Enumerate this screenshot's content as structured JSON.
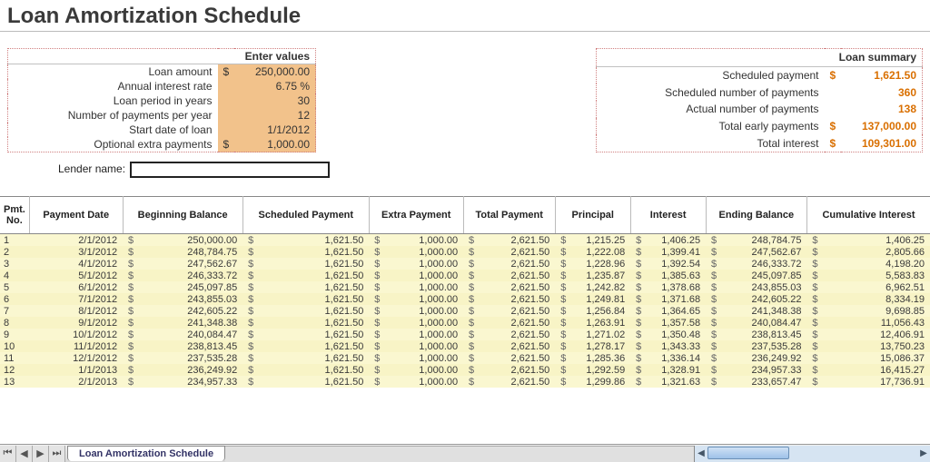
{
  "title": "Loan Amortization Schedule",
  "enter_values": {
    "header": "Enter values",
    "rows": [
      {
        "label": "Loan amount",
        "sym": "$",
        "value": "250,000.00"
      },
      {
        "label": "Annual interest rate",
        "sym": "",
        "value": "6.75  %"
      },
      {
        "label": "Loan period in years",
        "sym": "",
        "value": "30"
      },
      {
        "label": "Number of payments per year",
        "sym": "",
        "value": "12"
      },
      {
        "label": "Start date of loan",
        "sym": "",
        "value": "1/1/2012"
      },
      {
        "label": "Optional extra payments",
        "sym": "$",
        "value": "1,000.00"
      }
    ]
  },
  "loan_summary": {
    "header": "Loan summary",
    "rows": [
      {
        "label": "Scheduled payment",
        "sym": "$",
        "value": "1,621.50"
      },
      {
        "label": "Scheduled number of payments",
        "sym": "",
        "value": "360"
      },
      {
        "label": "Actual number of payments",
        "sym": "",
        "value": "138"
      },
      {
        "label": "Total early payments",
        "sym": "$",
        "value": "137,000.00"
      },
      {
        "label": "Total interest",
        "sym": "$",
        "value": "109,301.00"
      }
    ]
  },
  "lender": {
    "label": "Lender name:",
    "value": ""
  },
  "schedule": {
    "columns": [
      "Pmt. No.",
      "Payment Date",
      "Beginning Balance",
      "Scheduled Payment",
      "Extra Payment",
      "Total Payment",
      "Principal",
      "Interest",
      "Ending Balance",
      "Cumulative Interest"
    ],
    "rows": [
      {
        "no": "1",
        "date": "2/1/2012",
        "begin": "250,000.00",
        "sched": "1,621.50",
        "extra": "1,000.00",
        "total": "2,621.50",
        "principal": "1,215.25",
        "interest": "1,406.25",
        "end": "248,784.75",
        "cum": "1,406.25"
      },
      {
        "no": "2",
        "date": "3/1/2012",
        "begin": "248,784.75",
        "sched": "1,621.50",
        "extra": "1,000.00",
        "total": "2,621.50",
        "principal": "1,222.08",
        "interest": "1,399.41",
        "end": "247,562.67",
        "cum": "2,805.66"
      },
      {
        "no": "3",
        "date": "4/1/2012",
        "begin": "247,562.67",
        "sched": "1,621.50",
        "extra": "1,000.00",
        "total": "2,621.50",
        "principal": "1,228.96",
        "interest": "1,392.54",
        "end": "246,333.72",
        "cum": "4,198.20"
      },
      {
        "no": "4",
        "date": "5/1/2012",
        "begin": "246,333.72",
        "sched": "1,621.50",
        "extra": "1,000.00",
        "total": "2,621.50",
        "principal": "1,235.87",
        "interest": "1,385.63",
        "end": "245,097.85",
        "cum": "5,583.83"
      },
      {
        "no": "5",
        "date": "6/1/2012",
        "begin": "245,097.85",
        "sched": "1,621.50",
        "extra": "1,000.00",
        "total": "2,621.50",
        "principal": "1,242.82",
        "interest": "1,378.68",
        "end": "243,855.03",
        "cum": "6,962.51"
      },
      {
        "no": "6",
        "date": "7/1/2012",
        "begin": "243,855.03",
        "sched": "1,621.50",
        "extra": "1,000.00",
        "total": "2,621.50",
        "principal": "1,249.81",
        "interest": "1,371.68",
        "end": "242,605.22",
        "cum": "8,334.19"
      },
      {
        "no": "7",
        "date": "8/1/2012",
        "begin": "242,605.22",
        "sched": "1,621.50",
        "extra": "1,000.00",
        "total": "2,621.50",
        "principal": "1,256.84",
        "interest": "1,364.65",
        "end": "241,348.38",
        "cum": "9,698.85"
      },
      {
        "no": "8",
        "date": "9/1/2012",
        "begin": "241,348.38",
        "sched": "1,621.50",
        "extra": "1,000.00",
        "total": "2,621.50",
        "principal": "1,263.91",
        "interest": "1,357.58",
        "end": "240,084.47",
        "cum": "11,056.43"
      },
      {
        "no": "9",
        "date": "10/1/2012",
        "begin": "240,084.47",
        "sched": "1,621.50",
        "extra": "1,000.00",
        "total": "2,621.50",
        "principal": "1,271.02",
        "interest": "1,350.48",
        "end": "238,813.45",
        "cum": "12,406.91"
      },
      {
        "no": "10",
        "date": "11/1/2012",
        "begin": "238,813.45",
        "sched": "1,621.50",
        "extra": "1,000.00",
        "total": "2,621.50",
        "principal": "1,278.17",
        "interest": "1,343.33",
        "end": "237,535.28",
        "cum": "13,750.23"
      },
      {
        "no": "11",
        "date": "12/1/2012",
        "begin": "237,535.28",
        "sched": "1,621.50",
        "extra": "1,000.00",
        "total": "2,621.50",
        "principal": "1,285.36",
        "interest": "1,336.14",
        "end": "236,249.92",
        "cum": "15,086.37"
      },
      {
        "no": "12",
        "date": "1/1/2013",
        "begin": "236,249.92",
        "sched": "1,621.50",
        "extra": "1,000.00",
        "total": "2,621.50",
        "principal": "1,292.59",
        "interest": "1,328.91",
        "end": "234,957.33",
        "cum": "16,415.27"
      },
      {
        "no": "13",
        "date": "2/1/2013",
        "begin": "234,957.33",
        "sched": "1,621.50",
        "extra": "1,000.00",
        "total": "2,621.50",
        "principal": "1,299.86",
        "interest": "1,321.63",
        "end": "233,657.47",
        "cum": "17,736.91"
      }
    ]
  },
  "sheet_tab": "Loan Amortization Schedule",
  "chart_data": {
    "type": "table",
    "title": "Loan Amortization Schedule",
    "inputs": {
      "loan_amount": 250000.0,
      "annual_interest_rate_pct": 6.75,
      "loan_period_years": 30,
      "payments_per_year": 12,
      "start_date": "2012-01-01",
      "optional_extra_payment": 1000.0
    },
    "summary": {
      "scheduled_payment": 1621.5,
      "scheduled_number_of_payments": 360,
      "actual_number_of_payments": 138,
      "total_early_payments": 137000.0,
      "total_interest": 109301.0
    },
    "columns": [
      "pmt_no",
      "payment_date",
      "beginning_balance",
      "scheduled_payment",
      "extra_payment",
      "total_payment",
      "principal",
      "interest",
      "ending_balance",
      "cumulative_interest"
    ],
    "rows": [
      [
        1,
        "2012-02-01",
        250000.0,
        1621.5,
        1000.0,
        2621.5,
        1215.25,
        1406.25,
        248784.75,
        1406.25
      ],
      [
        2,
        "2012-03-01",
        248784.75,
        1621.5,
        1000.0,
        2621.5,
        1222.08,
        1399.41,
        247562.67,
        2805.66
      ],
      [
        3,
        "2012-04-01",
        247562.67,
        1621.5,
        1000.0,
        2621.5,
        1228.96,
        1392.54,
        246333.72,
        4198.2
      ],
      [
        4,
        "2012-05-01",
        246333.72,
        1621.5,
        1000.0,
        2621.5,
        1235.87,
        1385.63,
        245097.85,
        5583.83
      ],
      [
        5,
        "2012-06-01",
        245097.85,
        1621.5,
        1000.0,
        2621.5,
        1242.82,
        1378.68,
        243855.03,
        6962.51
      ],
      [
        6,
        "2012-07-01",
        243855.03,
        1621.5,
        1000.0,
        2621.5,
        1249.81,
        1371.68,
        242605.22,
        8334.19
      ],
      [
        7,
        "2012-08-01",
        242605.22,
        1621.5,
        1000.0,
        2621.5,
        1256.84,
        1364.65,
        241348.38,
        9698.85
      ],
      [
        8,
        "2012-09-01",
        241348.38,
        1621.5,
        1000.0,
        2621.5,
        1263.91,
        1357.58,
        240084.47,
        11056.43
      ],
      [
        9,
        "2012-10-01",
        240084.47,
        1621.5,
        1000.0,
        2621.5,
        1271.02,
        1350.48,
        238813.45,
        12406.91
      ],
      [
        10,
        "2012-11-01",
        238813.45,
        1621.5,
        1000.0,
        2621.5,
        1278.17,
        1343.33,
        237535.28,
        13750.23
      ],
      [
        11,
        "2012-12-01",
        237535.28,
        1621.5,
        1000.0,
        2621.5,
        1285.36,
        1336.14,
        236249.92,
        15086.37
      ],
      [
        12,
        "2013-01-01",
        236249.92,
        1621.5,
        1000.0,
        2621.5,
        1292.59,
        1328.91,
        234957.33,
        16415.27
      ],
      [
        13,
        "2013-02-01",
        234957.33,
        1621.5,
        1000.0,
        2621.5,
        1299.86,
        1321.63,
        233657.47,
        17736.91
      ]
    ]
  }
}
